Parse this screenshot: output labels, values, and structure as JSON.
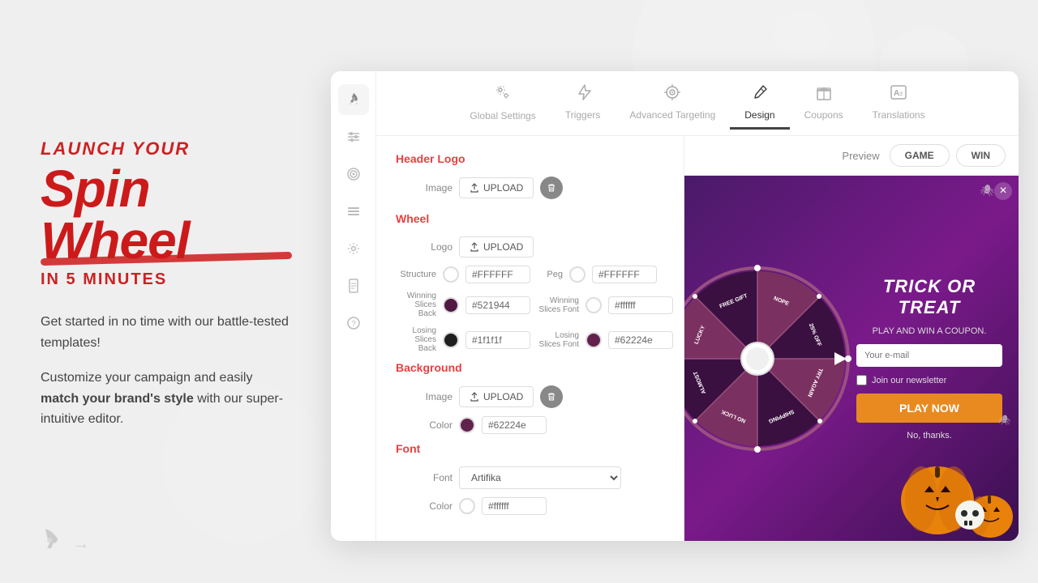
{
  "left": {
    "launch_your": "LAUNCH YOUR",
    "spin_wheel": "Spin Wheel",
    "in_5_minutes": "IN 5 MINUTES",
    "para1": "Get started in no time with our battle-tested templates!",
    "para2_plain": "Customize your campaign and easily ",
    "para2_bold": "match your brand's style",
    "para2_end": " with our super-intuitive editor."
  },
  "nav": {
    "items": [
      {
        "id": "global-settings",
        "label": "Global Settings",
        "icon": "⚙"
      },
      {
        "id": "triggers",
        "label": "Triggers",
        "icon": "⚡"
      },
      {
        "id": "advanced-targeting",
        "label": "Advanced Targeting",
        "icon": "🎯"
      },
      {
        "id": "design",
        "label": "Design",
        "icon": "✏"
      },
      {
        "id": "coupons",
        "label": "Coupons",
        "icon": "🎁"
      },
      {
        "id": "translations",
        "label": "Translations",
        "icon": "A±"
      }
    ]
  },
  "sidebar": {
    "items": [
      {
        "id": "rocket",
        "icon": "🚀"
      },
      {
        "id": "sliders",
        "icon": "⚙"
      },
      {
        "id": "target",
        "icon": "🎯"
      },
      {
        "id": "list",
        "icon": "☰"
      },
      {
        "id": "settings",
        "icon": "⚙"
      },
      {
        "id": "document",
        "icon": "📄"
      },
      {
        "id": "help",
        "icon": "❓"
      }
    ]
  },
  "settings": {
    "header_logo": {
      "title": "Header Logo",
      "image_label": "Image",
      "upload_label": "UPLOAD"
    },
    "wheel": {
      "title": "Wheel",
      "logo_label": "Logo",
      "upload_label": "UPLOAD",
      "structure_label": "Structure",
      "structure_color": "#FFFFFF",
      "peg_label": "Peg",
      "peg_color": "#FFFFFF",
      "winning_slices_back_label": "Winning Slices Back",
      "winning_slices_back_color": "#521944",
      "winning_slices_font_label": "Winning Slices Font",
      "winning_slices_font_color": "#ffffff",
      "losing_slices_back_label": "Losing Slices Back",
      "losing_slices_back_color": "#1f1f1f",
      "losing_slices_font_label": "Losing Slices Font",
      "losing_slices_font_color": "#62224e"
    },
    "background": {
      "title": "Background",
      "image_label": "Image",
      "upload_label": "UPLOAD",
      "color_label": "Color",
      "color_value": "#62224e",
      "color_swatch": "#62224e"
    },
    "font": {
      "title": "Font",
      "font_label": "Font",
      "font_value": "Artifika",
      "color_label": "Color",
      "color_value": "#ffffff",
      "color_swatch": "#ffffff"
    }
  },
  "preview": {
    "label": "Preview",
    "game_btn": "GAME",
    "win_btn": "WIN"
  },
  "popup": {
    "title": "TRICK OR TREAT",
    "subtitle": "PLAY AND WIN A COUPON.",
    "email_placeholder": "Your e-mail",
    "newsletter_label": "Join our newsletter",
    "play_btn": "PLAY NOW",
    "no_thanks": "No, thanks.",
    "wheel_labels": [
      "FREE GIFT",
      "NOPE",
      "25% OFF",
      "TRY AGAIN",
      "SHIPPING",
      "NO LUCK",
      "ALMOST"
    ]
  },
  "colors": {
    "accent_red": "#e84040",
    "dark_bg": "#4a1a6a",
    "orange": "#e88a20"
  }
}
